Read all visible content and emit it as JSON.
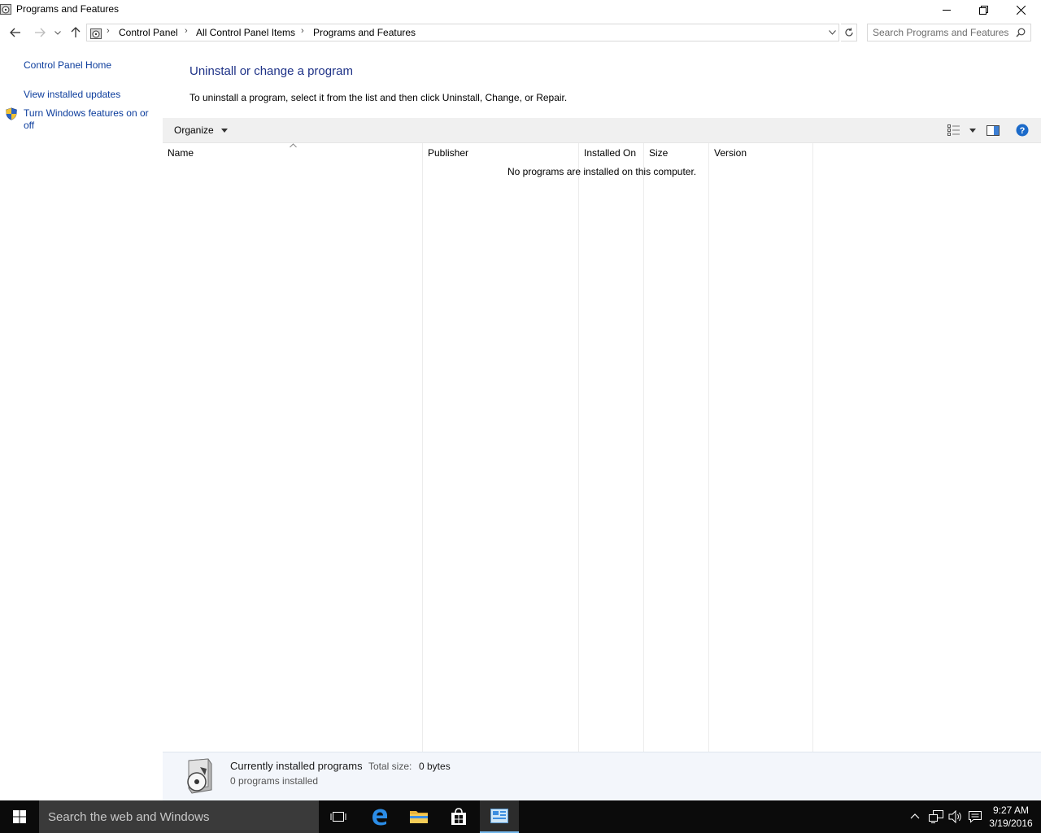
{
  "window": {
    "title": "Programs and Features"
  },
  "address": {
    "crumbs": [
      "Control Panel",
      "All Control Panel Items",
      "Programs and Features"
    ],
    "search_placeholder": "Search Programs and Features"
  },
  "left_pane": {
    "home": "Control Panel Home",
    "updates": "View installed updates",
    "features": "Turn Windows features on or off"
  },
  "main": {
    "heading": "Uninstall or change a program",
    "instruction": "To uninstall a program, select it from the list and then click Uninstall, Change, or Repair.",
    "organize_label": "Organize",
    "columns": [
      "Name",
      "Publisher",
      "Installed On",
      "Size",
      "Version"
    ],
    "empty_message": "No programs are installed on this computer."
  },
  "details": {
    "title": "Currently installed programs",
    "total_size_label": "Total size:",
    "total_size_value": "0 bytes",
    "count": "0 programs installed"
  },
  "taskbar": {
    "search_placeholder": "Search the web and Windows",
    "time": "9:27 AM",
    "date": "3/19/2016"
  },
  "colors": {
    "heading": "#1e3287",
    "link": "#0b3c9c",
    "taskbar": "#0b0b0b",
    "accent": "#76b9ed"
  }
}
